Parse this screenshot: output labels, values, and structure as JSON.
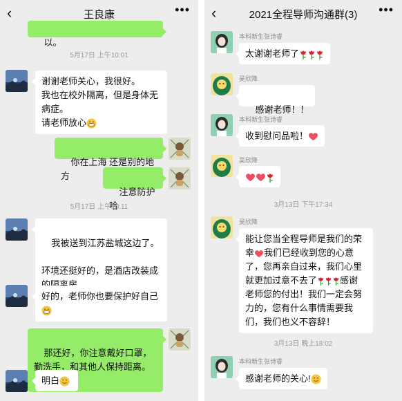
{
  "left_chat": {
    "title": "王良康",
    "back_icon": "chevron-left-icon",
    "more_icon": "more-dots-icon",
    "top_partial_text": "以。",
    "time1": "5月17日 上午10:01",
    "msg1": "谢谢老师关心，我很好。\n我也在校外隔离，但是身体无病症。\n请老师放心",
    "msg2": "你在上海 还是别的地方",
    "msg3": "注意防护哈",
    "time2": "5月17日 上午10:11",
    "msg4": "我被送到江苏盐城这边了。\n\n环境还挺好的，是酒店改装成的隔离房。",
    "msg5": "好的，老师你也要保护好自己",
    "msg6": "那还好，你注意戴好口罩，勤洗手，和其他人保持距离。",
    "msg7": "明白"
  },
  "right_chat": {
    "title": "2021全程导师沟通群(3)",
    "back_icon": "chevron-left-icon",
    "more_icon": "more-dots-icon",
    "sender_a": "本科新生张诗睿",
    "sender_b": "吴欣降",
    "msg1": "太谢谢老师了",
    "msg2": "感谢老师！！",
    "msg3": "收到慰问品啦！",
    "time1": "3月13日 下午17:34",
    "msg5": "能让您当全程导师是我们的荣幸",
    "msg5b": "我们已经收到您的心意了，您再亲自过来，我们心里就更加过意不去了",
    "msg5c": "感谢老师您的付出！我们一定会努力的，您有什么事情需要我们，我们也义不容辞！",
    "time2": "3月13日 晚上18:02",
    "msg6": "感谢老师的关心!"
  },
  "colors": {
    "bg": "#ededed",
    "sent_bubble": "#95ec69",
    "recv_bubble": "#ffffff",
    "timestamp": "#9a9a9a"
  }
}
